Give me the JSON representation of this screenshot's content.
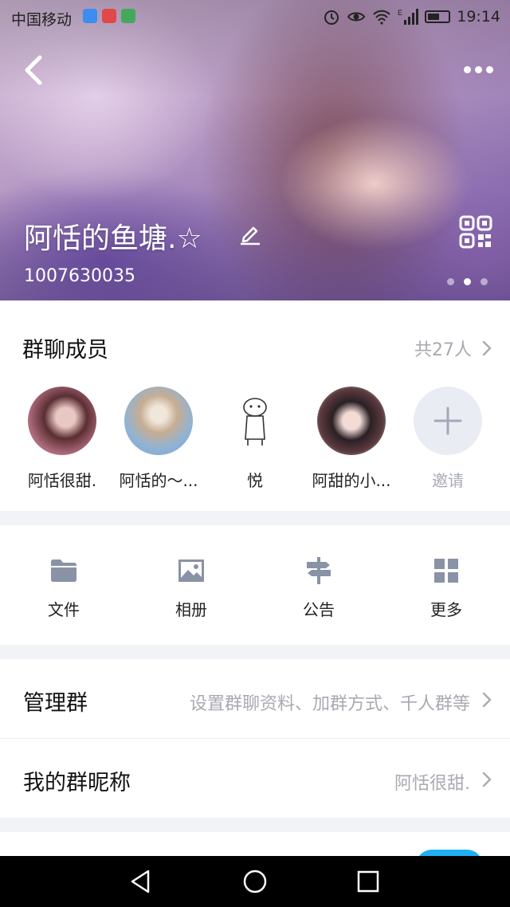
{
  "status_bar": {
    "carrier": "中国移动",
    "time": "19:14",
    "signal_label": "E"
  },
  "header": {
    "group_name": "阿恬的鱼塘.☆",
    "group_id": "1007630035",
    "page_dots": 3,
    "active_dot": 2
  },
  "members": {
    "title": "群聊成员",
    "count_text": "共27人",
    "items": [
      {
        "name": "阿恬很甜."
      },
      {
        "name": "阿恬的～..."
      },
      {
        "name": "悦"
      },
      {
        "name": "阿甜的小..."
      },
      {
        "name": "邀请"
      }
    ]
  },
  "features": [
    {
      "label": "文件",
      "icon": "folder-icon"
    },
    {
      "label": "相册",
      "icon": "photo-icon"
    },
    {
      "label": "公告",
      "icon": "signpost-icon"
    },
    {
      "label": "更多",
      "icon": "grid-icon"
    }
  ],
  "settings": {
    "manage": {
      "label": "管理群",
      "value": "设置群聊资料、加群方式、千人群等"
    },
    "nickname": {
      "label": "我的群昵称",
      "value": "阿恬很甜."
    }
  },
  "colors": {
    "accent": "#1fb0f2",
    "secondary_text": "#a9aab1",
    "icon_gray": "#8a92a6"
  }
}
